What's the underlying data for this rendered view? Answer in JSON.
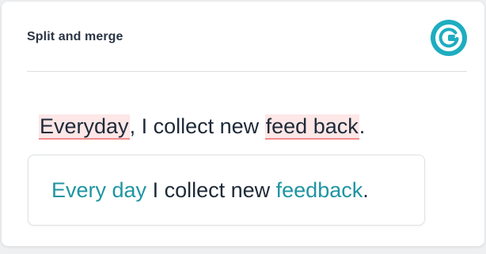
{
  "card": {
    "title": "Split and merge",
    "logo_icon": "grammarly-g-icon",
    "accent_color": "#1eadc0"
  },
  "original": {
    "word1": "Everyday",
    "text1": ", I collect new ",
    "word2": "feed back",
    "text2": "."
  },
  "suggestion": {
    "fix1": "Every day",
    "text1": " I collect new ",
    "fix2": "feedback",
    "text2": "."
  },
  "colors": {
    "error_highlight": "#fde7e7",
    "error_underline": "#f28b8b",
    "correction": "#1f95a2"
  }
}
